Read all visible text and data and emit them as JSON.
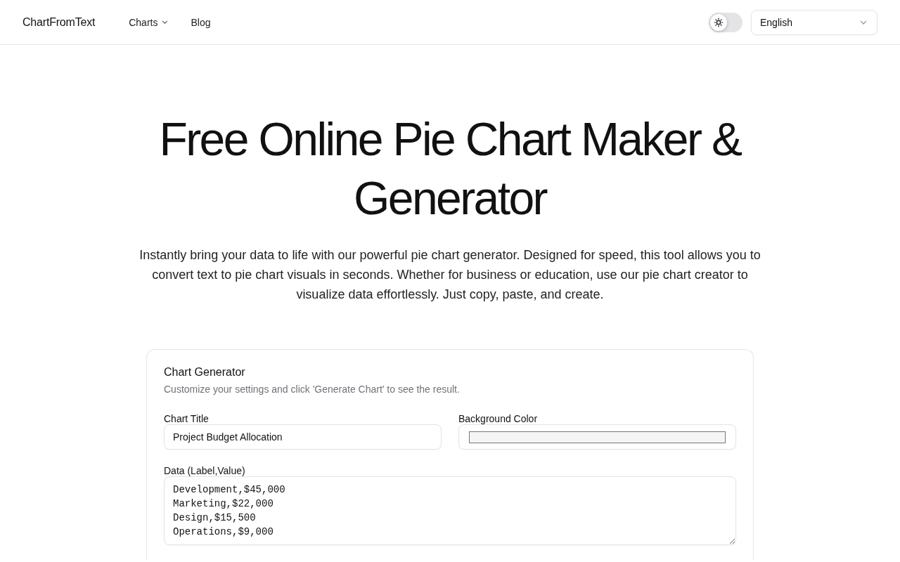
{
  "header": {
    "logo": "ChartFromText",
    "nav": [
      {
        "label": "Charts",
        "kind": "dropdown"
      },
      {
        "label": "Blog",
        "kind": "link"
      }
    ],
    "theme_toggle": {
      "on": false
    },
    "language_select": {
      "value": "English"
    }
  },
  "hero": {
    "title": "Free Online Pie Chart Maker & Generator",
    "description": "Instantly bring your data to life with our powerful pie chart generator. Designed for speed, this tool allows you to convert text to pie chart visuals in seconds. Whether for business or education, use our pie chart creator to visualize data effortlessly. Just copy, paste, and create."
  },
  "generator": {
    "title": "Chart Generator",
    "subtitle": "Customize your settings and click 'Generate Chart' to see the result.",
    "fields": [
      {
        "kind": "text",
        "label": "Chart Title",
        "value": "Project Budget Allocation"
      },
      {
        "kind": "color",
        "label": "Background Color",
        "color": "#f5f5f5"
      },
      {
        "kind": "textarea",
        "label": "Data (Label,Value)",
        "lines": [
          "Development,$45,000",
          "Marketing,$22,000",
          "Design,$15,500",
          "Operations,$9,000"
        ]
      }
    ]
  }
}
